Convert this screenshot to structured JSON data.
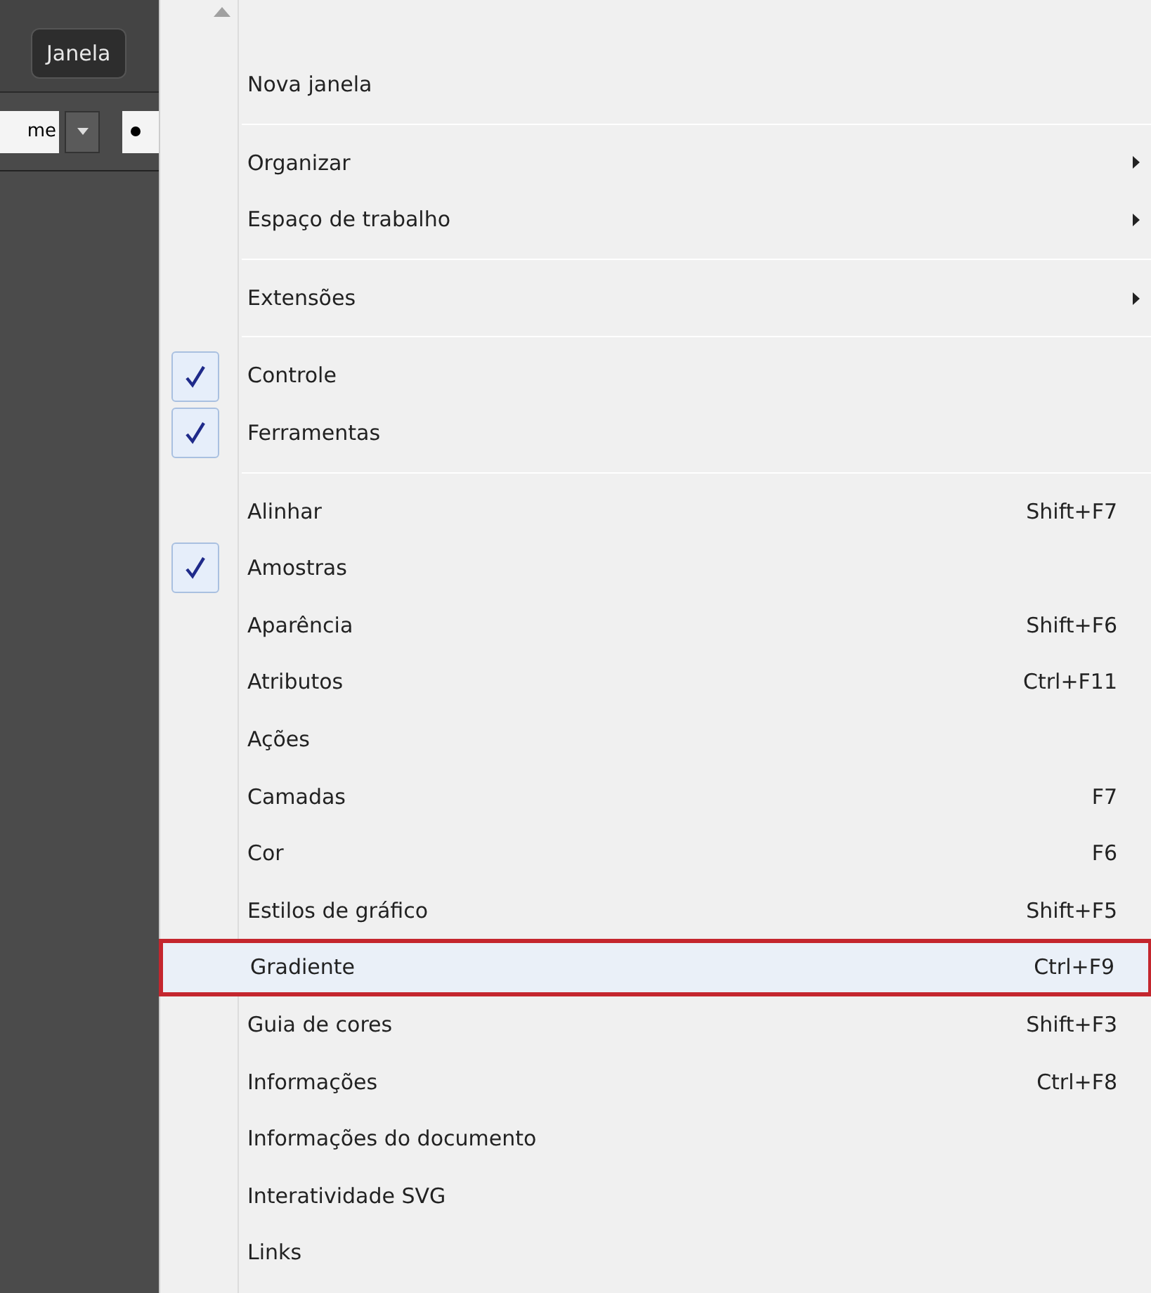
{
  "toolbar": {
    "menu_button": "Janela",
    "field_value": "me"
  },
  "menu": {
    "items": [
      {
        "kind": "item",
        "label": "Nova janela",
        "checked": false,
        "submenu": false,
        "highlighted": false
      },
      {
        "kind": "separator"
      },
      {
        "kind": "item",
        "label": "Organizar",
        "checked": false,
        "submenu": true,
        "highlighted": false
      },
      {
        "kind": "item",
        "label": "Espaço de trabalho",
        "checked": false,
        "submenu": true,
        "highlighted": false
      },
      {
        "kind": "separator"
      },
      {
        "kind": "item",
        "label": "Extensões",
        "checked": false,
        "submenu": true,
        "highlighted": false
      },
      {
        "kind": "separator"
      },
      {
        "kind": "item",
        "label": "Controle",
        "checked": true,
        "submenu": false,
        "highlighted": false
      },
      {
        "kind": "item",
        "label": "Ferramentas",
        "checked": true,
        "submenu": false,
        "highlighted": false
      },
      {
        "kind": "separator"
      },
      {
        "kind": "item",
        "label": "Alinhar",
        "shortcut": "Shift+F7",
        "checked": false,
        "submenu": false,
        "highlighted": false
      },
      {
        "kind": "item",
        "label": "Amostras",
        "checked": true,
        "submenu": false,
        "highlighted": false
      },
      {
        "kind": "item",
        "label": "Aparência",
        "shortcut": "Shift+F6",
        "checked": false,
        "submenu": false,
        "highlighted": false
      },
      {
        "kind": "item",
        "label": "Atributos",
        "shortcut": "Ctrl+F11",
        "checked": false,
        "submenu": false,
        "highlighted": false
      },
      {
        "kind": "item",
        "label": "Ações",
        "checked": false,
        "submenu": false,
        "highlighted": false
      },
      {
        "kind": "item",
        "label": "Camadas",
        "shortcut": "F7",
        "checked": false,
        "submenu": false,
        "highlighted": false
      },
      {
        "kind": "item",
        "label": "Cor",
        "shortcut": "F6",
        "checked": false,
        "submenu": false,
        "highlighted": false
      },
      {
        "kind": "item",
        "label": "Estilos de gráfico",
        "shortcut": "Shift+F5",
        "checked": false,
        "submenu": false,
        "highlighted": false
      },
      {
        "kind": "item",
        "label": "Gradiente",
        "shortcut": "Ctrl+F9",
        "checked": false,
        "submenu": false,
        "highlighted": true
      },
      {
        "kind": "item",
        "label": "Guia de cores",
        "shortcut": "Shift+F3",
        "checked": false,
        "submenu": false,
        "highlighted": false
      },
      {
        "kind": "item",
        "label": "Informações",
        "shortcut": "Ctrl+F8",
        "checked": false,
        "submenu": false,
        "highlighted": false
      },
      {
        "kind": "item",
        "label": "Informações do documento",
        "checked": false,
        "submenu": false,
        "highlighted": false
      },
      {
        "kind": "item",
        "label": "Interatividade SVG",
        "checked": false,
        "submenu": false,
        "highlighted": false
      },
      {
        "kind": "item",
        "label": "Links",
        "checked": false,
        "submenu": false,
        "highlighted": false
      }
    ]
  }
}
